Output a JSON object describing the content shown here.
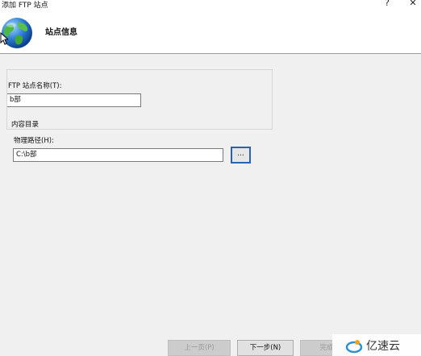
{
  "window": {
    "title": "添加 FTP 站点",
    "help_glyph": "?",
    "close_glyph": "✕"
  },
  "banner": {
    "title": "站点信息",
    "icon": "globe-icon"
  },
  "form": {
    "site_name_label": "FTP 站点名称(T):",
    "site_name_value": "b部",
    "content_group_label": "内容目录",
    "physical_path_label": "物理路径(H):",
    "physical_path_value": "C:\\b部",
    "browse_label": "..."
  },
  "footer": {
    "prev_label": "上一页(P)",
    "next_label": "下一步(N)",
    "finish_label": "完成"
  },
  "watermark": {
    "text": "亿速云"
  },
  "colors": {
    "content_bg": "#f0f0f0",
    "focus_border": "#2a62b0",
    "disabled_text": "#9a9a9a"
  }
}
